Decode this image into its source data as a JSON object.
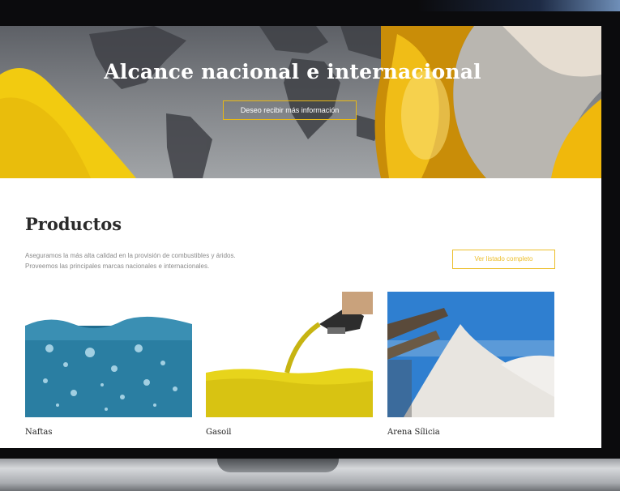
{
  "hero": {
    "title": "Alcance nacional e internacional",
    "cta_label": "Deseo recibir más información"
  },
  "products": {
    "title": "Productos",
    "description_lines": [
      "Aseguramos la más alta calidad en la provisión de combustibles y áridos.",
      "Proveemos las principales marcas nacionales e internacionales."
    ],
    "list_button_label": "Ver listado completo",
    "items": [
      {
        "name": "Naftas",
        "image": "water-bubbles-image"
      },
      {
        "name": "Gasoil",
        "image": "fuel-nozzle-image"
      },
      {
        "name": "Arena Sílicia",
        "image": "silica-sand-pile-image"
      }
    ]
  },
  "colors": {
    "accent": "#ecbe2a",
    "hero_gray": "#7d8084",
    "bezel": "#0b0b0d",
    "heading": "#2b2b2b"
  }
}
